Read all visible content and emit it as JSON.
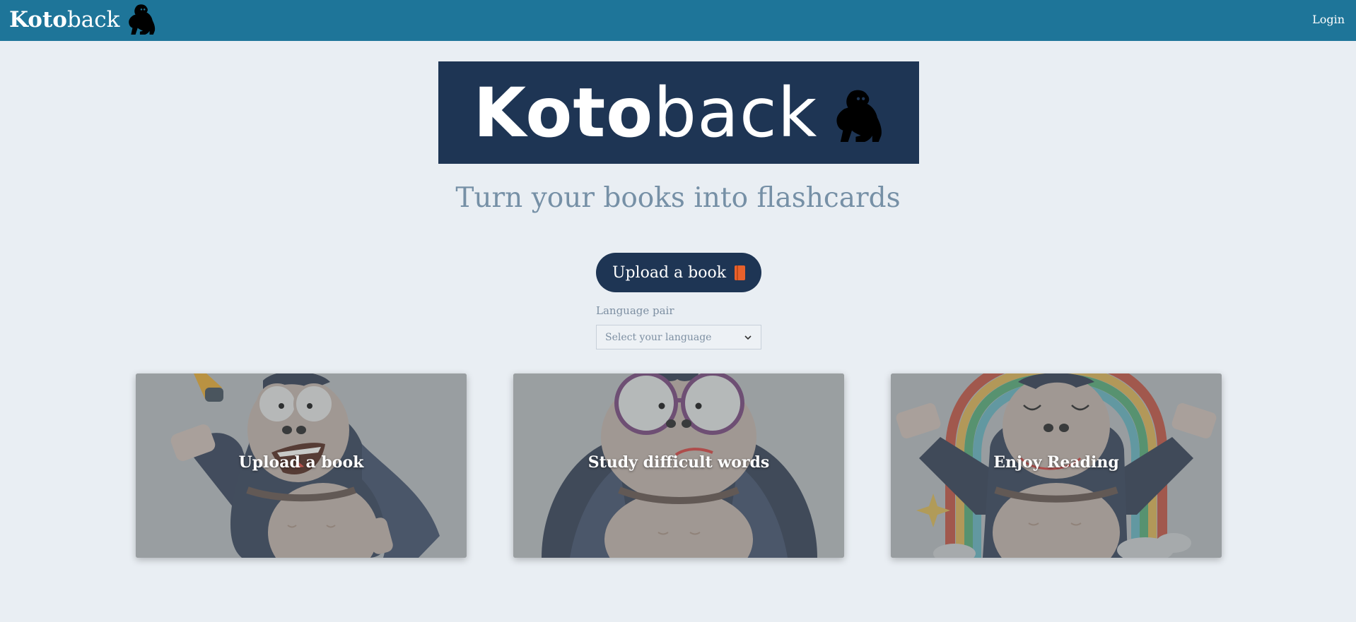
{
  "navbar": {
    "brand_bold": "Koto",
    "brand_light": "back",
    "brand_icon": "gorilla-icon",
    "login_label": "Login",
    "background": "#1e7599"
  },
  "hero": {
    "logo_bold": "Koto",
    "logo_light": "back",
    "logo_icon": "gorilla-icon",
    "logo_background": "#1e3554",
    "tagline": "Turn your books into flashcards"
  },
  "upload": {
    "button_label": "Upload a book",
    "button_icon": "book-icon",
    "language_label": "Language pair",
    "language_placeholder": "Select your language",
    "select_icon": "chevron-down-icon"
  },
  "cards": [
    {
      "title": "Upload a book",
      "illustration": "gorilla-idea-illustration"
    },
    {
      "title": "Study difficult words",
      "illustration": "gorilla-glasses-illustration"
    },
    {
      "title": "Enjoy Reading",
      "illustration": "gorilla-rainbow-illustration"
    }
  ]
}
